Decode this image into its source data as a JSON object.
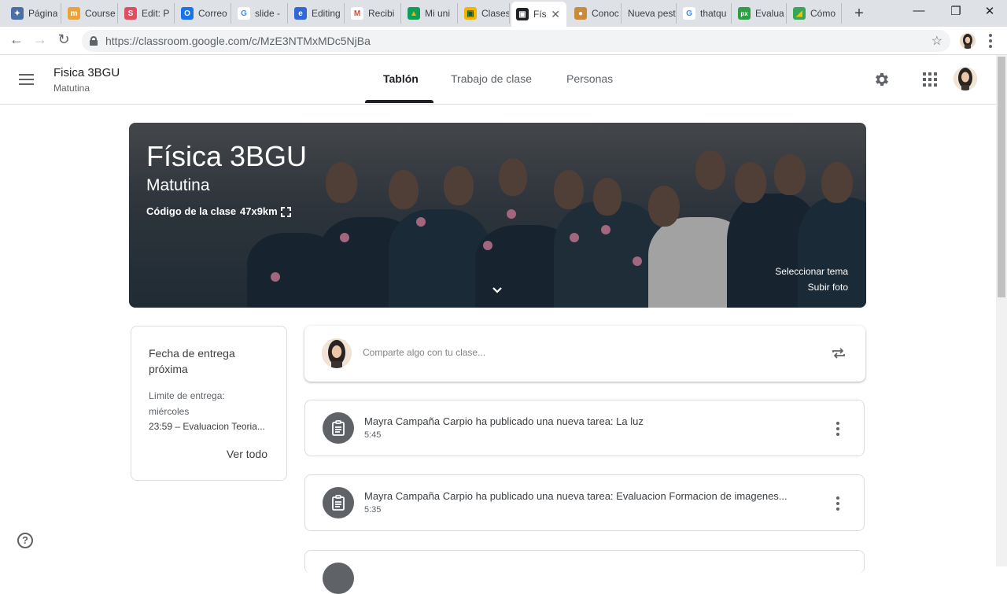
{
  "browser": {
    "tabs": [
      {
        "title": "Página",
        "color": "#4a6fa5",
        "glyph": "✦"
      },
      {
        "title": "Course",
        "color": "#e8a33d",
        "glyph": "m"
      },
      {
        "title": "Edit: P",
        "color": "#e04f5f",
        "glyph": "S"
      },
      {
        "title": "Correo",
        "color": "#1a73e8",
        "glyph": "O"
      },
      {
        "title": "slide -",
        "color": "#ffffff",
        "glyph": "G"
      },
      {
        "title": "Editing",
        "color": "#3367d6",
        "glyph": "e"
      },
      {
        "title": "Recibi",
        "color": "#ffffff",
        "glyph": "M"
      },
      {
        "title": "Mi uni",
        "color": "#0f9d58",
        "glyph": "▲"
      },
      {
        "title": "Clases",
        "color": "#f4b400",
        "glyph": "▣"
      },
      {
        "title": "Fís",
        "color": "#202124",
        "glyph": "▣"
      },
      {
        "title": "Conoc",
        "color": "#c98a3b",
        "glyph": "●"
      },
      {
        "title": "Nueva pest",
        "color": "",
        "glyph": ""
      },
      {
        "title": "thatqu",
        "color": "#ffffff",
        "glyph": "G"
      },
      {
        "title": "Evalua",
        "color": "#2e9e44",
        "glyph": "px"
      },
      {
        "title": "Cómo",
        "color": "#34a853",
        "glyph": "◢"
      }
    ],
    "url": "https://classroom.google.com/c/MzE3NTMxMDc5NjBa"
  },
  "header": {
    "class_name": "Fisica 3BGU",
    "section": "Matutina",
    "tabs": [
      "Tablón",
      "Trabajo de clase",
      "Personas"
    ]
  },
  "banner": {
    "title": "Física 3BGU",
    "subtitle": "Matutina",
    "code_label": "Código de la clase",
    "code_value": "47x9km",
    "theme_link": "Seleccionar tema",
    "upload_link": "Subir foto"
  },
  "due": {
    "title": "Fecha de entrega próxima",
    "limit_label": "Límite de entrega:",
    "limit_day": "miércoles",
    "item": "23:59 – Evaluacion Teoria...",
    "view_all": "Ver todo"
  },
  "share": {
    "placeholder": "Comparte algo con tu clase..."
  },
  "posts": [
    {
      "text": "Mayra Campaña Carpio ha publicado una nueva tarea: La luz",
      "time": "5:45"
    },
    {
      "text": "Mayra Campaña Carpio ha publicado una nueva tarea: Evaluacion Formacion de imagenes...",
      "time": "5:35"
    }
  ]
}
